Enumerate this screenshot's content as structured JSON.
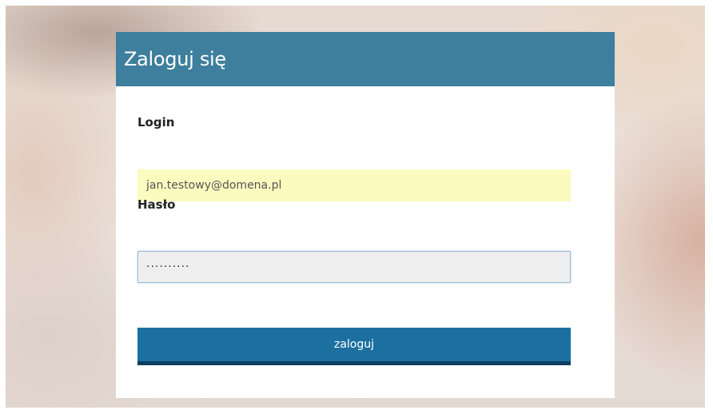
{
  "login_card": {
    "title": "Zaloguj się",
    "login": {
      "label": "Login",
      "value": "jan.testowy@domena.pl"
    },
    "password": {
      "label": "Hasło",
      "masked_value": "··········"
    },
    "submit_label": "zaloguj"
  },
  "colors": {
    "header_bg": "#3d7f9d",
    "button_bg": "#1c70a0",
    "button_border": "#0e3f5f",
    "login_autofill_bg": "#fbfbbf",
    "password_bg": "#efeeee"
  }
}
